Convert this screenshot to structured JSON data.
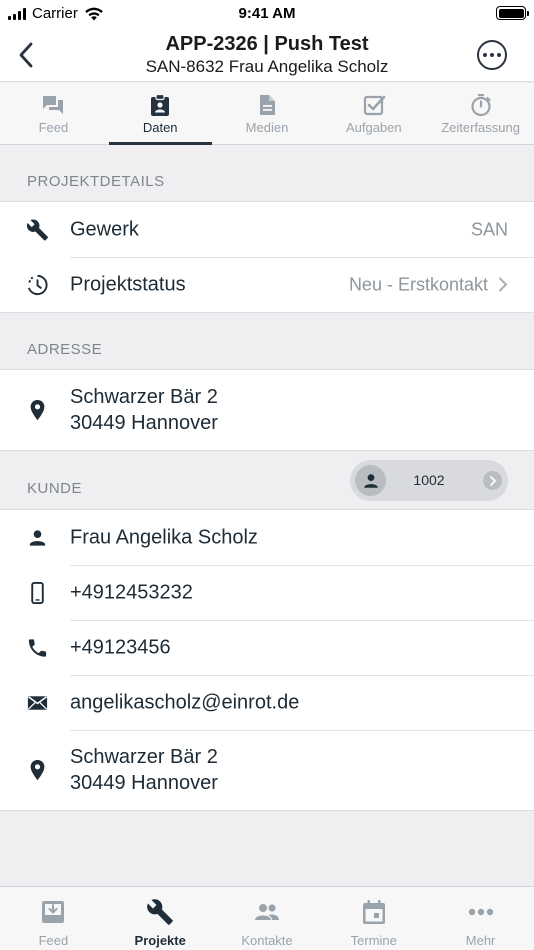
{
  "status_bar": {
    "carrier": "Carrier",
    "time": "9:41 AM"
  },
  "nav": {
    "title": "APP-2326 | Push Test",
    "subtitle": "SAN-8632 Frau Angelika Scholz"
  },
  "tabs": [
    {
      "label": "Feed",
      "icon": "chat-icon",
      "active": false
    },
    {
      "label": "Daten",
      "icon": "clipboard-icon",
      "active": true
    },
    {
      "label": "Medien",
      "icon": "document-icon",
      "active": false
    },
    {
      "label": "Aufgaben",
      "icon": "checkbox-icon",
      "active": false
    },
    {
      "label": "Zeiterfassung",
      "icon": "stopwatch-icon",
      "active": false
    }
  ],
  "projektdetails": {
    "heading": "PROJEKTDETAILS",
    "gewerk": {
      "label": "Gewerk",
      "value": "SAN",
      "icon": "wrench-icon"
    },
    "projektstatus": {
      "label": "Projektstatus",
      "value": "Neu - Erstkontakt",
      "icon": "status-icon"
    }
  },
  "adresse": {
    "heading": "ADRESSE",
    "street": "Schwarzer Bär 2",
    "city": "30449 Hannover",
    "icon": "location-pin-icon"
  },
  "kunde": {
    "heading": "KUNDE",
    "badge_number": "1002",
    "name": "Frau Angelika Scholz",
    "mobile": "+4912453232",
    "phone": "+49123456",
    "email": "angelikascholz@einrot.de",
    "street": "Schwarzer Bär 2",
    "city": "30449 Hannover"
  },
  "bottom_tabs": [
    {
      "label": "Feed",
      "icon": "inbox-icon",
      "active": false
    },
    {
      "label": "Projekte",
      "icon": "wrench-icon",
      "active": true
    },
    {
      "label": "Kontakte",
      "icon": "people-icon",
      "active": false
    },
    {
      "label": "Termine",
      "icon": "calendar-icon",
      "active": false
    },
    {
      "label": "Mehr",
      "icon": "more-dots-icon",
      "active": false
    }
  ],
  "colors": {
    "accent": "#24333f",
    "inactive": "#9aa3ab",
    "background": "#efeff1"
  }
}
